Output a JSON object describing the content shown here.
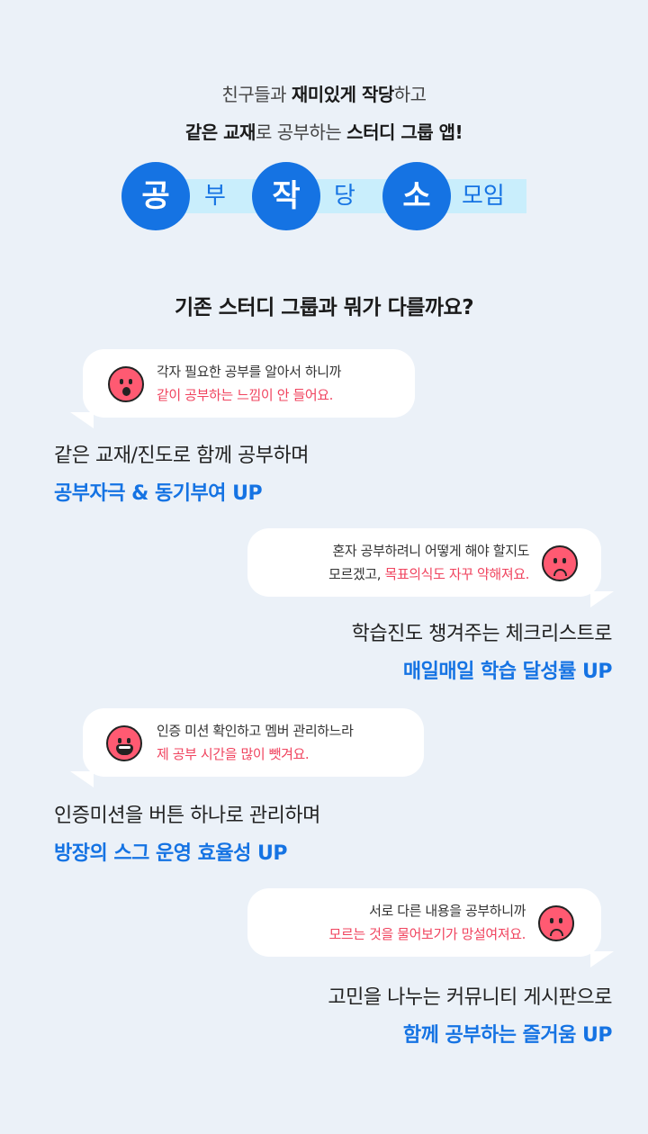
{
  "intro": {
    "line1": {
      "a": "친구들과 ",
      "b": "재미있게 작당",
      "c": "하고"
    },
    "line2": {
      "a": "같은 교재",
      "b": "로 공부하는 ",
      "c": "스터디 그룹 앱!"
    }
  },
  "logo": {
    "c1": "공",
    "s1": "부",
    "c2": "작",
    "s2": "당",
    "c3": "소",
    "s3": "모임"
  },
  "question": "기존 스터디 그룹과 뭐가 다를까요?",
  "sections": [
    {
      "bubble_line1": "각자 필요한 공부를 알아서 하니까",
      "bubble_line2": "같이 공부하는 느낌이 안 들어요.",
      "claim_line1": "같은 교재/진도로 함께 공부하며",
      "claim_line2": "공부자극 & 동기부여 UP"
    },
    {
      "bubble_line1": "혼자 공부하려니 어떻게 해야 할지도",
      "bubble_line2a": "모르겠고, ",
      "bubble_line2b": "목표의식도 자꾸 약해져요.",
      "claim_line1": "학습진도 챙겨주는 체크리스트로",
      "claim_line2": "매일매일 학습 달성률 UP"
    },
    {
      "bubble_line1": "인증 미션 확인하고 멤버 관리하느라",
      "bubble_line2": "제 공부 시간을 많이 뺏겨요.",
      "claim_line1": "인증미션을 버튼 하나로 관리하며",
      "claim_line2": "방장의 스그 운영 효율성 UP"
    },
    {
      "bubble_line1": "서로 다른 내용을 공부하니까",
      "bubble_line2": "모르는 것을 물어보기가 망설여져요.",
      "claim_line1": "고민을 나누는 커뮤니티 게시판으로",
      "claim_line2": "함께 공부하는 즐거움 UP"
    }
  ],
  "colors": {
    "accent": "#1573e3",
    "pink": "#f0445f",
    "face": "#ff5a72",
    "band": "#c9eefc",
    "background": "#ebf1f8"
  }
}
